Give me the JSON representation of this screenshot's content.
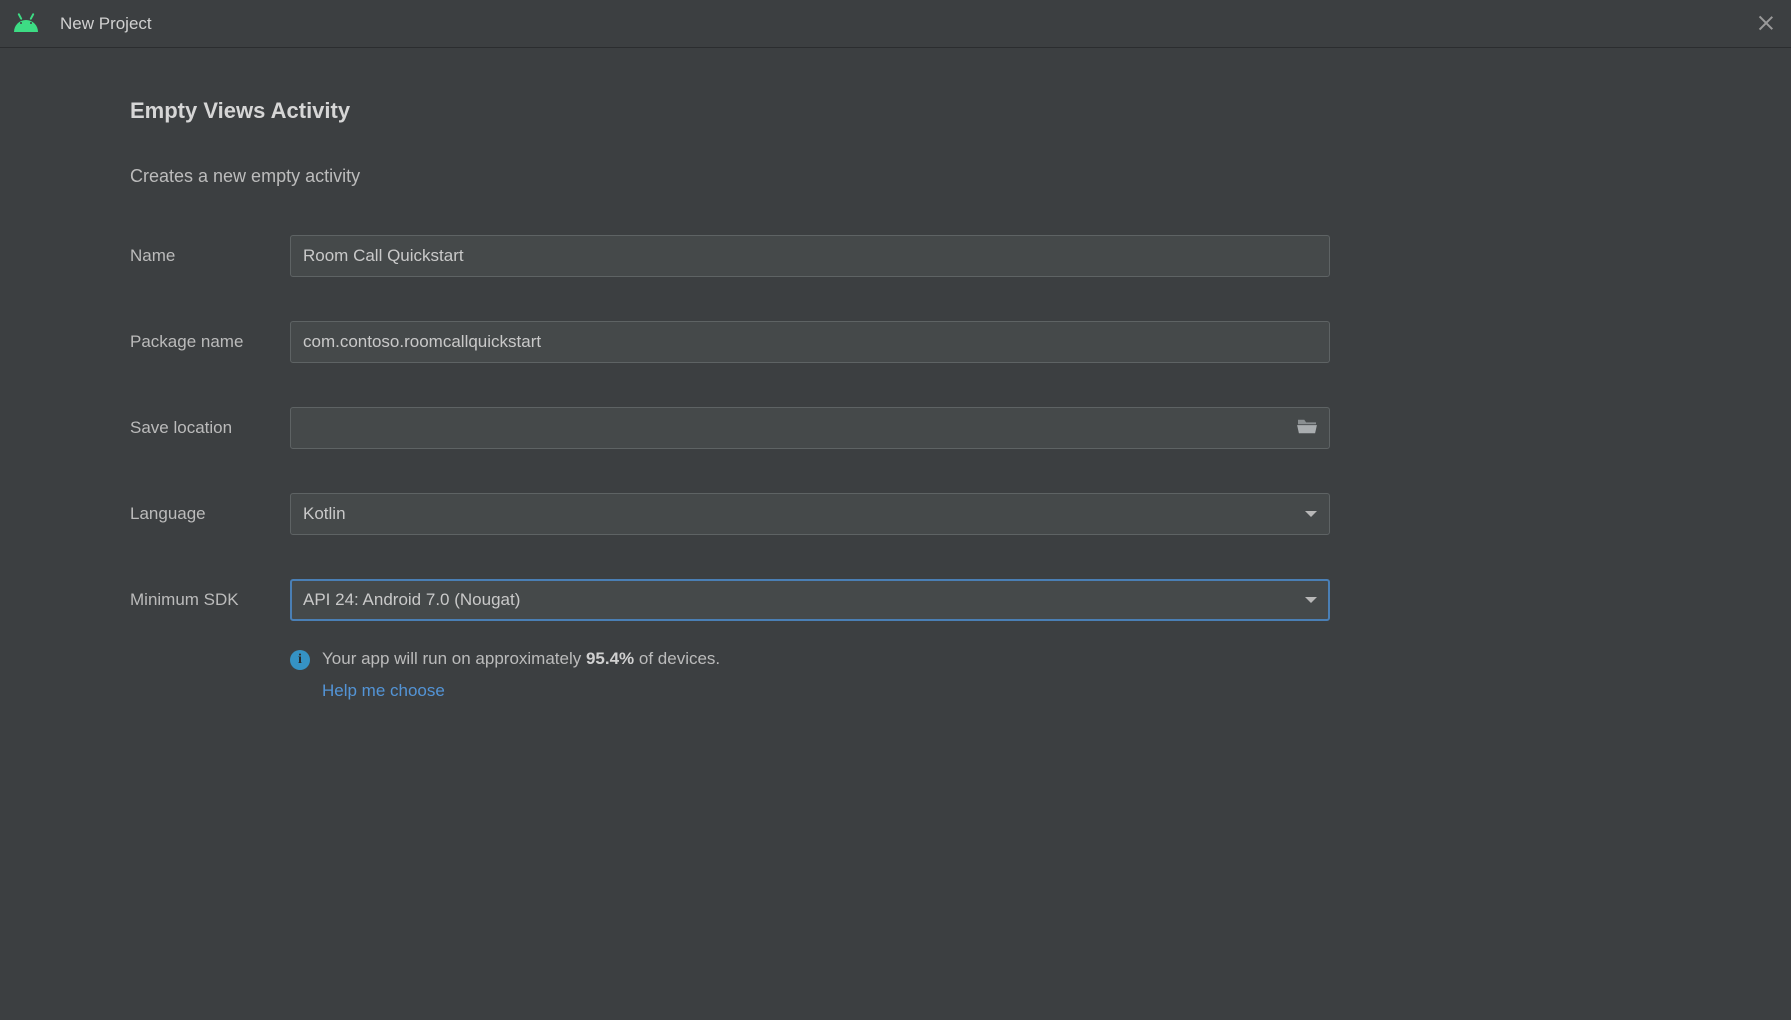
{
  "window": {
    "title": "New Project"
  },
  "page": {
    "heading": "Empty Views Activity",
    "description": "Creates a new empty activity"
  },
  "form": {
    "name_label": "Name",
    "name_value": "Room Call Quickstart",
    "package_label": "Package name",
    "package_value": "com.contoso.roomcallquickstart",
    "save_label": "Save location",
    "save_value": "",
    "language_label": "Language",
    "language_value": "Kotlin",
    "sdk_label": "Minimum SDK",
    "sdk_value": "API 24: Android 7.0 (Nougat)"
  },
  "hint": {
    "prefix": "Your app will run on approximately ",
    "percent": "95.4%",
    "suffix": " of devices.",
    "help_link": "Help me choose"
  }
}
